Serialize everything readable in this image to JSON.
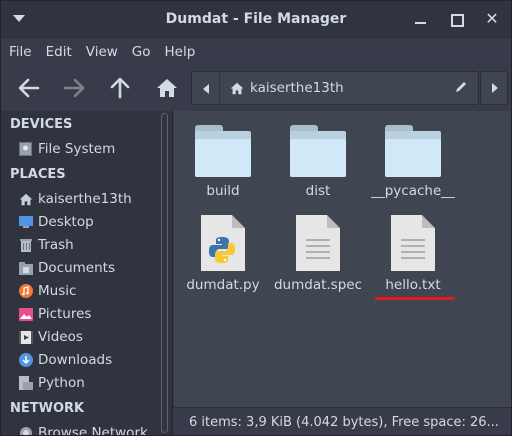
{
  "window": {
    "title": "Dumdat - File Manager"
  },
  "menubar": {
    "items": [
      "File",
      "Edit",
      "View",
      "Go",
      "Help"
    ]
  },
  "pathbar": {
    "current": "kaiserthe13th"
  },
  "sidebar": {
    "devices_header": "DEVICES",
    "devices": [
      {
        "label": "File System",
        "icon": "drive-icon"
      }
    ],
    "places_header": "PLACES",
    "places": [
      {
        "label": "kaiserthe13th",
        "icon": "home-icon"
      },
      {
        "label": "Desktop",
        "icon": "desktop-icon"
      },
      {
        "label": "Trash",
        "icon": "trash-icon"
      },
      {
        "label": "Documents",
        "icon": "documents-folder-icon"
      },
      {
        "label": "Music",
        "icon": "music-icon"
      },
      {
        "label": "Pictures",
        "icon": "pictures-icon"
      },
      {
        "label": "Videos",
        "icon": "videos-icon"
      },
      {
        "label": "Downloads",
        "icon": "downloads-icon"
      },
      {
        "label": "Python",
        "icon": "folder-icon"
      }
    ],
    "network_header": "NETWORK",
    "network": [
      {
        "label": "Browse Network",
        "icon": "network-icon"
      }
    ]
  },
  "files": [
    {
      "name": "build",
      "type": "folder"
    },
    {
      "name": "dist",
      "type": "folder"
    },
    {
      "name": "__pycache__",
      "type": "folder"
    },
    {
      "name": "dumdat.py",
      "type": "python"
    },
    {
      "name": "dumdat.spec",
      "type": "text"
    },
    {
      "name": "hello.txt",
      "type": "text"
    }
  ],
  "statusbar": {
    "text": "6 items: 3,9 KiB (4.042 bytes), Free space: 26..."
  },
  "colors": {
    "accent_annotation": "#e01b24",
    "folder": "#d1e8f9",
    "background": "#404552"
  }
}
